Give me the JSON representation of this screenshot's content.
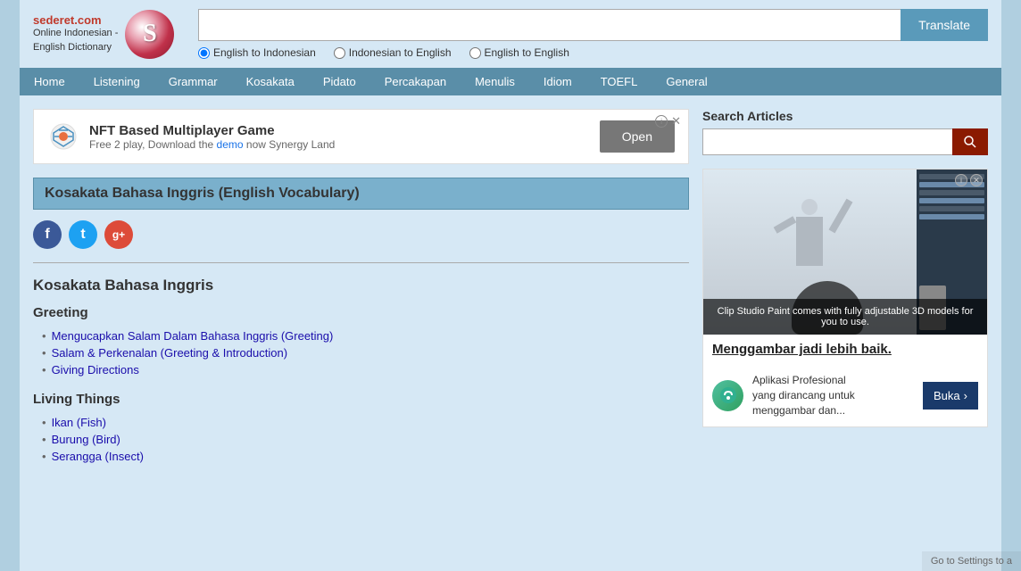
{
  "header": {
    "site_name": "sederet.com",
    "site_subtitle": "Online Indonesian -\nEnglish Dictionary",
    "logo_letter": "S",
    "search_placeholder": "",
    "translate_btn": "Translate",
    "radio_options": [
      {
        "id": "r1",
        "label": "English to Indonesian",
        "checked": true
      },
      {
        "id": "r2",
        "label": "Indonesian to English",
        "checked": false
      },
      {
        "id": "r3",
        "label": "English to English",
        "checked": false
      }
    ]
  },
  "navbar": {
    "items": [
      {
        "label": "Home"
      },
      {
        "label": "Listening"
      },
      {
        "label": "Grammar"
      },
      {
        "label": "Kosakata"
      },
      {
        "label": "Pidato"
      },
      {
        "label": "Percakapan"
      },
      {
        "label": "Menulis"
      },
      {
        "label": "Idiom"
      },
      {
        "label": "TOEFL"
      },
      {
        "label": "General"
      }
    ]
  },
  "ad": {
    "icon_label": "g-icon",
    "title": "NFT Based Multiplayer Game",
    "subtitle": "Free 2 play, Download the demo now Synergy Land",
    "open_btn": "Open",
    "info_symbol": "i",
    "close_symbol": "✕"
  },
  "page": {
    "title": "Kosakata Bahasa Inggris (English Vocabulary)",
    "social": [
      {
        "name": "Facebook",
        "letter": "f"
      },
      {
        "name": "Twitter",
        "letter": "t"
      },
      {
        "name": "Google+",
        "letter": "g+"
      }
    ],
    "content_h2": "Kosakata Bahasa Inggris",
    "sections": [
      {
        "heading": "Greeting",
        "links": [
          "Mengucapkan Salam Dalam Bahasa Inggris (Greeting)",
          "Salam & Perkenalan (Greeting & Introduction)",
          "Giving Directions"
        ]
      },
      {
        "heading": "Living Things",
        "links": [
          "Ikan (Fish)",
          "Burung (Bird)",
          "Serangga (Insect)"
        ]
      }
    ]
  },
  "sidebar": {
    "search_label": "Search Articles",
    "search_placeholder": "",
    "search_btn_icon": "🔍",
    "ad_caption": "Clip Studio Paint comes with\nfully adjustable 3D models for you to use.",
    "ad_heading": "Menggambar jadi lebih baik.",
    "ad_desc_line1": "Aplikasi Profesional",
    "ad_desc_line2": "yang dirancang untuk",
    "ad_desc_line3": "menggambar dan...",
    "ad_cta": "Buka",
    "ad_cta_arrow": "›",
    "ad_ctrl_info": "i",
    "ad_ctrl_close": "✕"
  },
  "watermark": {
    "line1": "Go to Settings to a"
  }
}
